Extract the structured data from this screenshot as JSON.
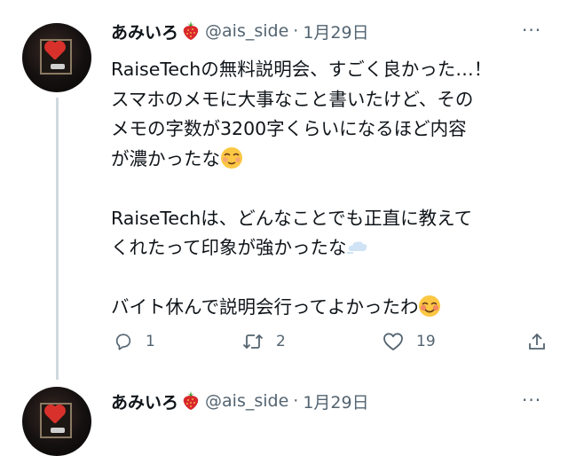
{
  "tweet1": {
    "author_name": "あみいろ",
    "name_emoji": "strawberry-emoji",
    "handle": "@ais_side",
    "separator": "·",
    "date": "1月29日",
    "more": "···",
    "paragraphs": [
      [
        "RaiseTechの無料説明会、すごく良かった…！",
        "スマホのメモに大事なこと書いたけど、その",
        "メモの字数が3200字くらいになるほど内容",
        "が濃かったな"
      ],
      [
        "RaiseTechは、どんなことでも正直に教えて",
        "くれたって印象が強かったな"
      ],
      [
        "バイト休んで説明会行ってよかったわ"
      ]
    ],
    "emojis": [
      "relieved-face-emoji",
      "dash-cloud-emoji",
      "smiling-face-emoji"
    ],
    "reply_count": "1",
    "retweet_count": "2",
    "like_count": "19"
  },
  "tweet2": {
    "author_name": "あみいろ",
    "handle": "@ais_side",
    "separator": "·",
    "date": "1月29日",
    "more": "···"
  },
  "colors": {
    "text": "#0f1419",
    "secondary": "#536471",
    "thread_line": "#cfd9de"
  }
}
